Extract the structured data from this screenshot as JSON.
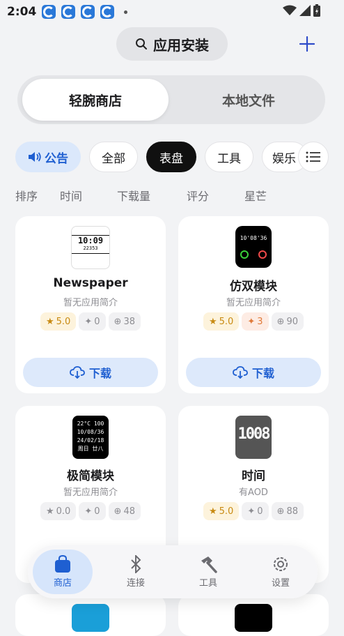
{
  "status": {
    "time": "2:04"
  },
  "search": {
    "label": "应用安装"
  },
  "tabs": [
    {
      "label": "轻腕商店"
    },
    {
      "label": "本地文件"
    }
  ],
  "filters": {
    "announcement": "公告",
    "chips": [
      "全部",
      "表盘",
      "工具",
      "娱乐"
    ]
  },
  "sort": [
    "排序",
    "时间",
    "下载量",
    "评分",
    "星芒"
  ],
  "apps": [
    {
      "name": "Newspaper",
      "desc": "暂无应用简介",
      "rating": "5.0",
      "stars": "0",
      "downloads": "38",
      "download_label": "下载"
    },
    {
      "name": "仿双模块",
      "desc": "暂无应用简介",
      "rating": "5.0",
      "stars": "3",
      "downloads": "90",
      "download_label": "下载"
    },
    {
      "name": "极简模块",
      "desc": "暂无应用简介",
      "rating": "0.0",
      "stars": "0",
      "downloads": "48"
    },
    {
      "name": "时间",
      "desc": "有AOD",
      "rating": "5.0",
      "stars": "0",
      "downloads": "88"
    }
  ],
  "watch_faces": {
    "newspaper": [
      "10:09",
      "22353"
    ],
    "dual": [
      "10'08'36"
    ],
    "minimal": [
      "22°C 100",
      "10/08/36",
      "24/02/18",
      "周日 廿八"
    ],
    "time": [
      "1008"
    ]
  },
  "nav": [
    {
      "label": "商店",
      "icon": "bag-icon"
    },
    {
      "label": "连接",
      "icon": "bluetooth-icon"
    },
    {
      "label": "工具",
      "icon": "hammer-icon"
    },
    {
      "label": "设置",
      "icon": "gear-icon"
    }
  ],
  "colors": {
    "accent": "#1f5fd1",
    "rating": "#c88a12",
    "star": "#e07a3a"
  }
}
